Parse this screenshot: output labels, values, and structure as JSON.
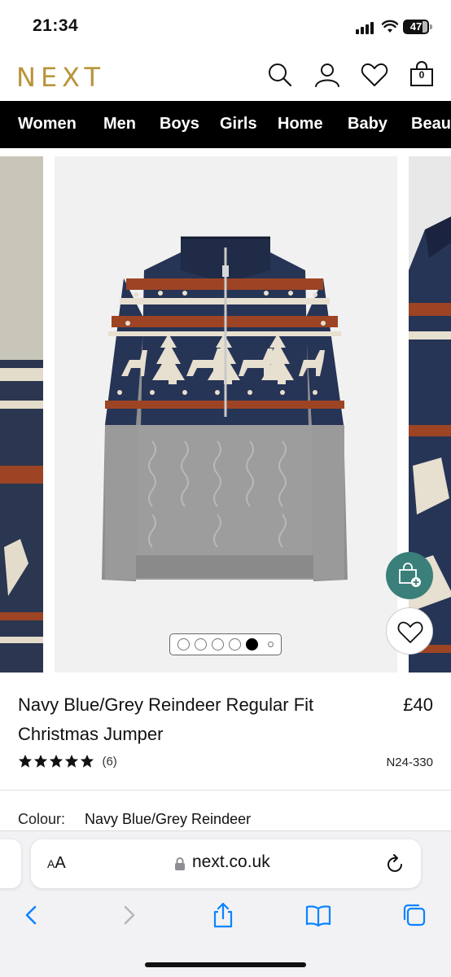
{
  "status": {
    "time": "21:34",
    "battery": "47"
  },
  "header": {
    "logo": "NEXT",
    "icons": [
      "search-icon",
      "account-icon",
      "favourites-icon",
      "bag-icon"
    ],
    "bag_count": "0"
  },
  "nav": {
    "items": [
      "Women",
      "Men",
      "Boys",
      "Girls",
      "Home",
      "Baby",
      "Beauty"
    ]
  },
  "gallery": {
    "dots_total": 6,
    "active_index": 4
  },
  "product": {
    "title": "Navy Blue/Grey Reindeer Regular Fit Christmas Jumper",
    "price": "£40",
    "rating": 5,
    "review_count": "(6)",
    "sku": "N24-330",
    "colour_label": "Colour:",
    "colour_value": "Navy Blue/Grey Reindeer"
  },
  "browser": {
    "aa_label": "AA",
    "url": "next.co.uk"
  },
  "colors": {
    "brand_gold": "#b9943a",
    "nav_bg": "#000000",
    "bag_button": "#3a7f7a"
  }
}
